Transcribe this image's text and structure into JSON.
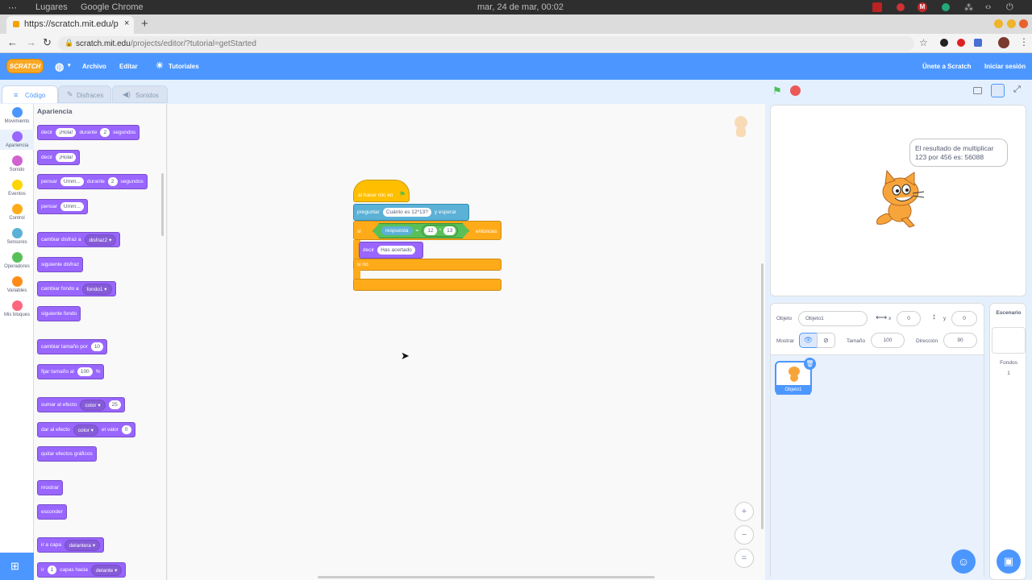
{
  "os": {
    "places": "Lugares",
    "app": "Google Chrome",
    "clock": "mar, 24 de mar, 00:02"
  },
  "browser": {
    "tab_title": "https://scratch.mit.edu/p",
    "url_host": "scratch.mit.edu",
    "url_path": "/projects/editor/?tutorial=getStarted"
  },
  "menu": {
    "logo": "SCRATCH",
    "file": "Archivo",
    "edit": "Editar",
    "tutorials": "Tutoriales",
    "join": "Únete a Scratch",
    "signin": "Iniciar sesión"
  },
  "tabs": {
    "code": "Código",
    "costumes": "Disfraces",
    "sounds": "Sonidos"
  },
  "categories": [
    {
      "label": "Movimiento",
      "color": "#4c97ff"
    },
    {
      "label": "Apariencia",
      "color": "#9966ff"
    },
    {
      "label": "Sonido",
      "color": "#cf63cf"
    },
    {
      "label": "Eventos",
      "color": "#ffd500"
    },
    {
      "label": "Control",
      "color": "#ffab19"
    },
    {
      "label": "Sensores",
      "color": "#5cb1d6"
    },
    {
      "label": "Operadores",
      "color": "#59c059"
    },
    {
      "label": "Variables",
      "color": "#ff8c1a"
    },
    {
      "label": "Mis bloques",
      "color": "#ff6680"
    }
  ],
  "palette": {
    "heading": "Apariencia",
    "b1": {
      "a": "decir",
      "v1": "¡Hola!",
      "b": "durante",
      "v2": "2",
      "c": "segundos"
    },
    "b2": {
      "a": "decir",
      "v1": "¡Hola!"
    },
    "b3": {
      "a": "pensar",
      "v1": "Umm...",
      "b": "durante",
      "v2": "2",
      "c": "segundos"
    },
    "b4": {
      "a": "pensar",
      "v1": "Umm..."
    },
    "b5": {
      "a": "cambiar disfraz a",
      "v1": "disfraz2 ▾"
    },
    "b6": {
      "a": "siguiente disfraz"
    },
    "b7": {
      "a": "cambiar fondo a",
      "v1": "fondo1 ▾"
    },
    "b8": {
      "a": "siguiente fondo"
    },
    "b9": {
      "a": "cambiar tamaño por",
      "v1": "10"
    },
    "b10": {
      "a": "fijar tamaño al",
      "v1": "100",
      "b": "%"
    },
    "b11": {
      "a": "sumar al efecto",
      "v1": "color ▾",
      "b": "",
      "v2": "25"
    },
    "b12": {
      "a": "dar al efecto",
      "v1": "color ▾",
      "b": "el valor",
      "v2": "0"
    },
    "b13": {
      "a": "quitar efectos gráficos"
    },
    "b14": {
      "a": "mostrar"
    },
    "b15": {
      "a": "esconder"
    },
    "b16": {
      "a": "ir a capa",
      "v1": "delantera ▾"
    },
    "b17": {
      "a": "ir",
      "v1": "1",
      "b": "capas hacia",
      "v2": "delante ▾"
    }
  },
  "script": {
    "hat": "al hacer clic en",
    "ask": "preguntar",
    "ask_value": "Cuánto es 12*13?",
    "ask_end": "y esperar",
    "if": "si",
    "answer": "respuesta",
    "eq": "=",
    "n1": "12",
    "mul": "*",
    "n2": "13",
    "then": "entonces",
    "say": "decir",
    "say_value": "Has acertado",
    "else": "si no"
  },
  "zoom": {
    "in": "+",
    "out": "−",
    "reset": "="
  },
  "stage": {
    "bubble": "El resultado de multiplicar 123 por 456 es: 56088"
  },
  "sprite": {
    "label": "Objeto",
    "name": "Objeto1",
    "x_label": "x",
    "x": "0",
    "y_label": "y",
    "y": "0",
    "show_label": "Mostrar",
    "size_label": "Tamaño",
    "size": "100",
    "dir_label": "Dirección",
    "dir": "90",
    "thumb_name": "Objeto1"
  },
  "stage_pane": {
    "title": "Escenario",
    "backdrops_label": "Fondos",
    "backdrops_count": "1"
  },
  "colors": {
    "looks": "#9966ff",
    "events": "#ffbf00",
    "control": "#ffab19",
    "sensing": "#5cb1d6",
    "operators": "#59c059",
    "accent": "#4c97ff"
  }
}
